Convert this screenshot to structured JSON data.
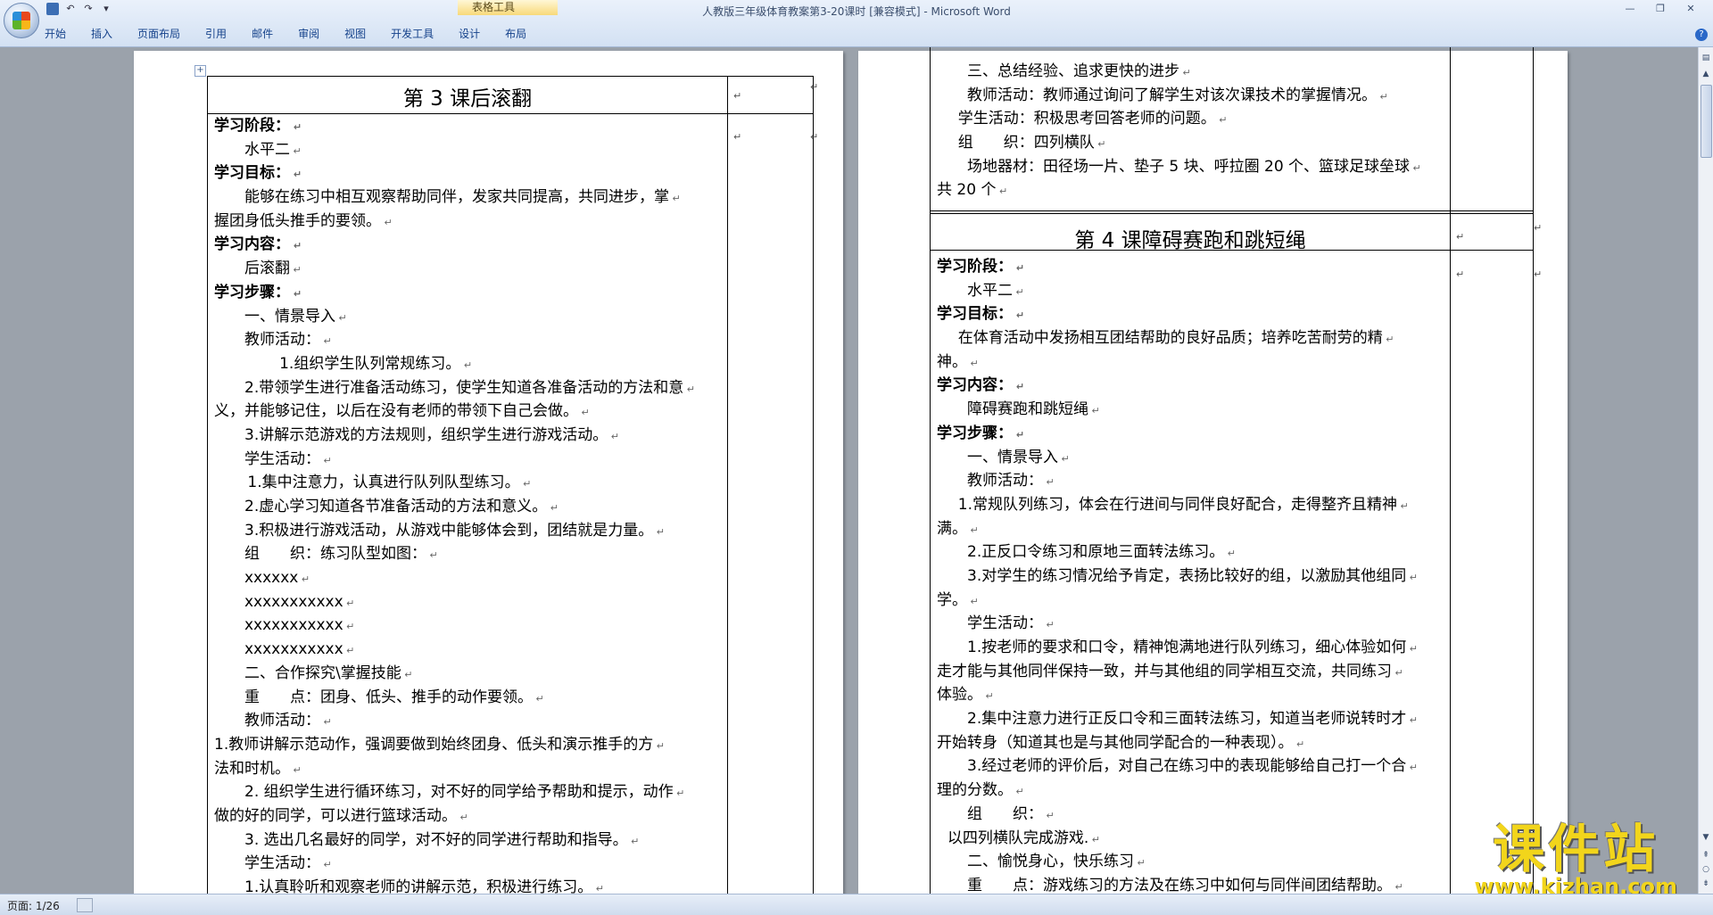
{
  "window": {
    "title": "人教版三年级体育教案第3-20课时 [兼容模式] - Microsoft Word"
  },
  "ribbon": {
    "context_tab_header": "表格工具",
    "tabs": [
      "开始",
      "插入",
      "页面布局",
      "引用",
      "邮件",
      "审阅",
      "视图",
      "开发工具",
      "设计",
      "布局"
    ]
  },
  "page1": {
    "title": "第 3 课后滚翻",
    "lines": [
      {
        "t": "学习阶段：",
        "bold": true,
        "indent": 0
      },
      {
        "t": "水平二",
        "indent": 2
      },
      {
        "t": "学习目标：",
        "bold": true,
        "indent": 0
      },
      {
        "t": "能够在练习中相互观察帮助同伴，发家共同提高，共同进步，掌",
        "indent": 2
      },
      {
        "t": "握团身低头推手的要领。",
        "indent": 0
      },
      {
        "t": "学习内容：",
        "bold": true,
        "indent": 0
      },
      {
        "t": "后滚翻",
        "indent": 2
      },
      {
        "t": "学习步骤：",
        "bold": true,
        "indent": 0
      },
      {
        "t": "一、情景导入",
        "indent": 2
      },
      {
        "t": "教师活动：",
        "indent": 2
      },
      {
        "t": "1.组织学生队列常规练习。",
        "indent": 4.3
      },
      {
        "t": "2.带领学生进行准备活动练习，使学生知道各准备活动的方法和意",
        "indent": 2
      },
      {
        "t": "义，并能够记住，以后在没有老师的带领下自己会做。",
        "indent": 0
      },
      {
        "t": "3.讲解示范游戏的方法规则，组织学生进行游戏活动。",
        "indent": 2
      },
      {
        "t": "学生活动：",
        "indent": 2
      },
      {
        "t": "1.集中注意力，认真进行队列队型练习。",
        "indent": 2.2
      },
      {
        "t": "2.虚心学习知道各节准备活动的方法和意义。",
        "indent": 2
      },
      {
        "t": "3.积极进行游戏活动，从游戏中能够体会到，团结就是力量。",
        "indent": 2
      },
      {
        "t": "组　　织：练习队型如图：",
        "indent": 2
      },
      {
        "t": "xxxxxx",
        "indent": 2
      },
      {
        "t": "xxxxxxxxxxx",
        "indent": 2
      },
      {
        "t": "xxxxxxxxxxx",
        "indent": 2
      },
      {
        "t": "xxxxxxxxxxx",
        "indent": 2
      },
      {
        "t": "二、合作探究\\掌握技能",
        "indent": 2
      },
      {
        "t": "重　　点：团身、低头、推手的动作要领。",
        "indent": 2
      },
      {
        "t": "教师活动：",
        "indent": 2
      },
      {
        "t": "1.教师讲解示范动作，强调要做到始终团身、低头和演示推手的方",
        "indent": 0
      },
      {
        "t": "法和时机。",
        "indent": 0
      },
      {
        "t": "2. 组织学生进行循环练习，对不好的同学给予帮助和提示，动作",
        "indent": 2
      },
      {
        "t": "做的好的同学，可以进行篮球活动。",
        "indent": 0
      },
      {
        "t": "3. 选出几名最好的同学，对不好的同学进行帮助和指导。",
        "indent": 2
      },
      {
        "t": "学生活动：",
        "indent": 2
      },
      {
        "t": "1.认真聆听和观察老师的讲解示范，积极进行练习。",
        "indent": 2
      }
    ]
  },
  "page2": {
    "top_lines": [
      {
        "t": "三、总结经验、追求更快的进步",
        "indent": 2
      },
      {
        "t": "教师活动：教师通过询问了解学生对该次课技术的掌握情况。",
        "indent": 2
      },
      {
        "t": "学生活动：积极思考回答老师的问题。",
        "indent": 1.4
      },
      {
        "t": "组　　织：四列横队",
        "indent": 1.4
      },
      {
        "t": "场地器材：田径场一片、垫子 5 块、呼拉圈 20 个、篮球足球垒球",
        "indent": 2
      },
      {
        "t": "共 20 个",
        "indent": 0
      }
    ],
    "title": "第 4 课障碍赛跑和跳短绳",
    "lines": [
      {
        "t": "学习阶段：",
        "bold": true,
        "indent": 0
      },
      {
        "t": "水平二",
        "indent": 2
      },
      {
        "t": "学习目标：",
        "bold": true,
        "indent": 0
      },
      {
        "t": "在体育活动中发扬相互团结帮助的良好品质；培养吃苦耐劳的精",
        "indent": 1.4
      },
      {
        "t": "神。",
        "indent": 0
      },
      {
        "t": "学习内容：",
        "bold": true,
        "indent": 0
      },
      {
        "t": "障碍赛跑和跳短绳",
        "indent": 2
      },
      {
        "t": "学习步骤：",
        "bold": true,
        "indent": 0
      },
      {
        "t": "一、情景导入",
        "indent": 2
      },
      {
        "t": "教师活动：",
        "indent": 2
      },
      {
        "t": "1.常规队列练习，体会在行进间与同伴良好配合，走得整齐且精神",
        "indent": 1.4
      },
      {
        "t": "满。",
        "indent": 0
      },
      {
        "t": "2.正反口令练习和原地三面转法练习。",
        "indent": 2
      },
      {
        "t": "3.对学生的练习情况给予肯定，表扬比较好的组，以激励其他组同",
        "indent": 2
      },
      {
        "t": "学。",
        "indent": 0
      },
      {
        "t": "学生活动：",
        "indent": 2
      },
      {
        "t": "1.按老师的要求和口令，精神饱满地进行队列练习，细心体验如何",
        "indent": 2
      },
      {
        "t": "走才能与其他同伴保持一致，并与其他组的同学相互交流，共同练习",
        "indent": 0
      },
      {
        "t": "体验。",
        "indent": 0
      },
      {
        "t": "2.集中注意力进行正反口令和三面转法练习，知道当老师说转时才",
        "indent": 2
      },
      {
        "t": "开始转身（知道其也是与其他同学配合的一种表现）。",
        "indent": 0
      },
      {
        "t": "3.经过老师的评价后，对自己在练习中的表现能够给自己打一个合",
        "indent": 2
      },
      {
        "t": "理的分数。",
        "indent": 0
      },
      {
        "t": "组　　织：",
        "indent": 2
      },
      {
        "t": "以四列横队完成游戏.",
        "indent": 0.7
      },
      {
        "t": "二、愉悦身心，快乐练习",
        "indent": 2
      },
      {
        "t": "重　　点：游戏练习的方法及在练习中如何与同伴间团结帮助。",
        "indent": 2
      }
    ]
  },
  "statusbar": {
    "page_info": "页面: 1/26"
  },
  "watermark": {
    "text": "课件站",
    "url": "www.kjzhan.com"
  },
  "colors": {
    "ribbon_text": "#15428b",
    "watermark": "#f2d51b"
  }
}
